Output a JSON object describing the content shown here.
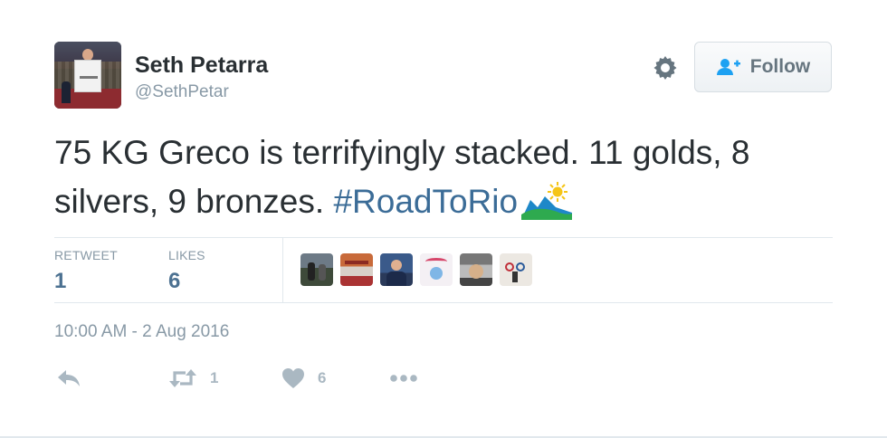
{
  "tweet": {
    "author": {
      "name": "Seth Petarra",
      "handle": "@SethPetar",
      "avatar_icon": "profile-photo"
    },
    "text": "75 KG Greco is terrifyingly stacked. 11 golds, 8 silvers, 9 bronzes.",
    "hashtag": "#RoadToRio",
    "hashtag_emoji_icon": "rio-mountains-sun-icon",
    "timestamp": "10:00 AM - 2 Aug 2016"
  },
  "header": {
    "settings_icon": "gear-icon",
    "follow_label": "Follow",
    "follow_icon": "add-user-icon"
  },
  "stats": {
    "retweet_label": "RETWEET",
    "retweet_count": "1",
    "likes_label": "LIKES",
    "likes_count": "6",
    "likers_count_shown": 6
  },
  "actions": {
    "reply_icon": "reply-icon",
    "retweet_icon": "retweet-icon",
    "retweet_count": "1",
    "like_icon": "heart-icon",
    "like_count": "6",
    "more_icon": "more-dots-icon"
  },
  "colors": {
    "text": "#292f33",
    "muted": "#8899a6",
    "link": "#3b6c97",
    "stat_value": "#4c7191",
    "action_icon": "#aab8c2",
    "divider": "#e1e8ed"
  }
}
